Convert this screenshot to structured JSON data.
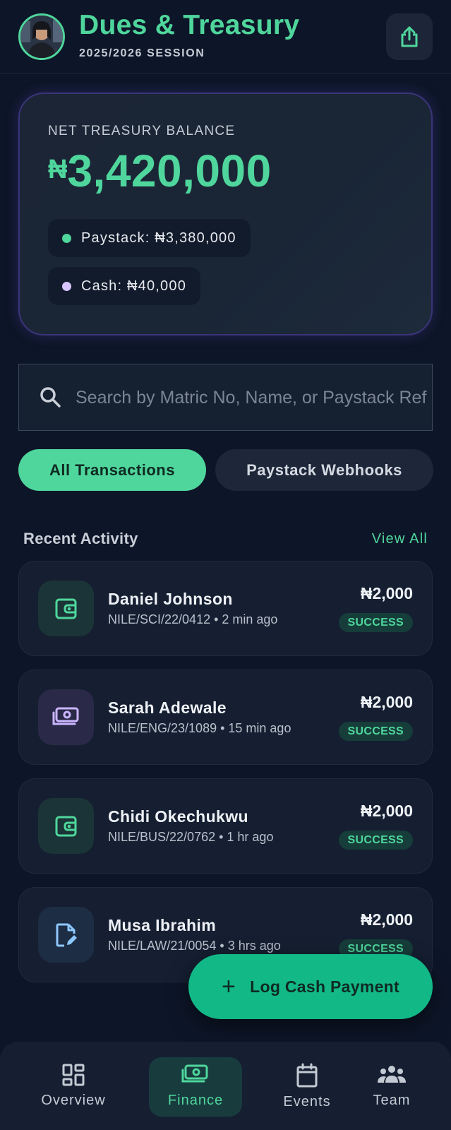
{
  "header": {
    "title": "Dues & Treasury",
    "subtitle": "2025/2026 SESSION",
    "avatar_icon": "profile-photo",
    "share_icon": "share-icon"
  },
  "balance": {
    "label": "NET TREASURY BALANCE",
    "currency": "₦",
    "amount": "3,420,000",
    "paystack_label": "Paystack: ₦3,380,000",
    "cash_label": "Cash: ₦40,000",
    "colors": {
      "accent": "#4fd69c",
      "paystack_dot": "#4fd69c",
      "cash_dot": "#d8c4ff"
    }
  },
  "search": {
    "placeholder": "Search by Matric No, Name, or Paystack Ref",
    "value": ""
  },
  "tabs": [
    {
      "label": "All Transactions",
      "active": true
    },
    {
      "label": "Paystack Webhooks",
      "active": false
    }
  ],
  "activity": {
    "title": "Recent Activity",
    "view_all": "View All",
    "transactions": [
      {
        "name": "Daniel Johnson",
        "meta": "NILE/SCI/22/0412 • 2 min ago",
        "amount": "₦2,000",
        "status": "SUCCESS",
        "icon": "wallet-icon"
      },
      {
        "name": "Sarah Adewale",
        "meta": "NILE/ENG/23/1089 • 15 min ago",
        "amount": "₦2,000",
        "status": "SUCCESS",
        "icon": "cash-icon"
      },
      {
        "name": "Chidi Okechukwu",
        "meta": "NILE/BUS/22/0762 • 1 hr ago",
        "amount": "₦2,000",
        "status": "SUCCESS",
        "icon": "wallet-icon"
      },
      {
        "name": "Musa Ibrahim",
        "meta": "NILE/LAW/21/0054 • 3 hrs ago",
        "amount": "₦2,000",
        "status": "SUCCESS",
        "icon": "file-edit-icon"
      }
    ]
  },
  "fab": {
    "label": "Log Cash Payment"
  },
  "nav": [
    {
      "label": "Overview",
      "icon": "dashboard-icon",
      "active": false
    },
    {
      "label": "Finance",
      "icon": "cash-icon",
      "active": true
    },
    {
      "label": "Events",
      "icon": "calendar-icon",
      "active": false
    },
    {
      "label": "Team",
      "icon": "group-icon",
      "active": false
    }
  ]
}
